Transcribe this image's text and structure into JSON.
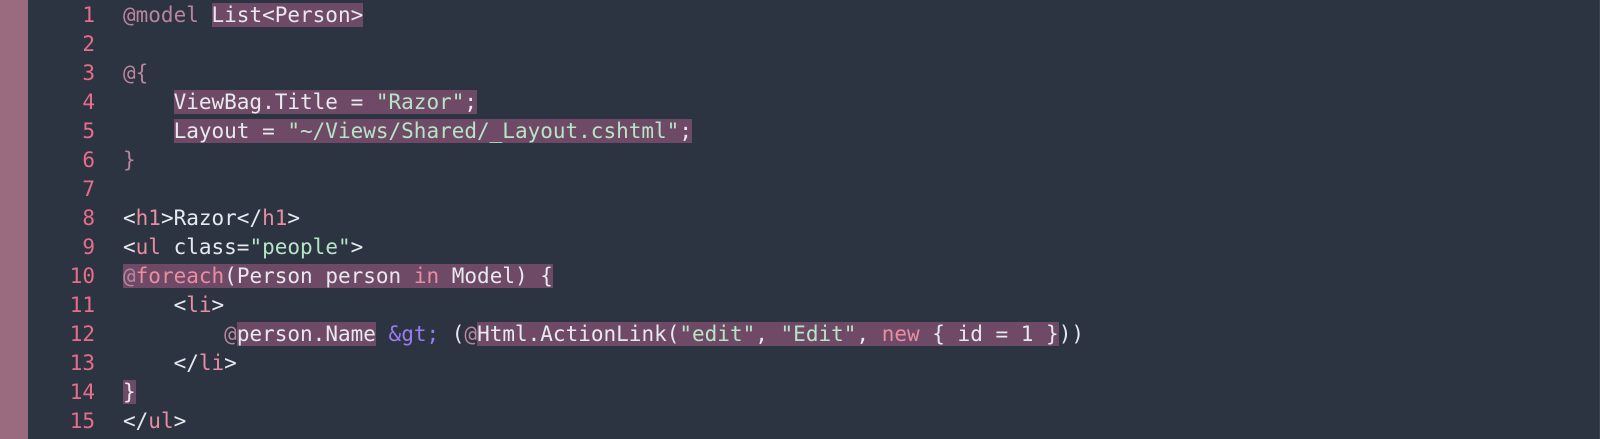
{
  "editor": {
    "language": "Razor (cshtml)",
    "colors": {
      "background": "#2c3441",
      "gutter_bar": "#9a6a7e",
      "line_number": "#e86d8a",
      "highlight": "#6f4a66"
    },
    "lines": [
      {
        "number": "1",
        "segments": [
          {
            "text": "@model ",
            "cls": "at"
          },
          {
            "text": "List<Person>",
            "cls": "pun hl"
          }
        ]
      },
      {
        "number": "2",
        "segments": []
      },
      {
        "number": "3",
        "segments": [
          {
            "text": "@{",
            "cls": "at"
          }
        ]
      },
      {
        "number": "4",
        "segments": [
          {
            "text": "    ",
            "cls": ""
          },
          {
            "text": "ViewBag.Title = ",
            "cls": "pun hl"
          },
          {
            "text": "\"Razor\"",
            "cls": "str hl"
          },
          {
            "text": ";",
            "cls": "pun hl"
          }
        ]
      },
      {
        "number": "5",
        "segments": [
          {
            "text": "    ",
            "cls": ""
          },
          {
            "text": "Layout = ",
            "cls": "pun hl"
          },
          {
            "text": "\"~/Views/Shared/_Layout.cshtml\"",
            "cls": "str hl"
          },
          {
            "text": ";",
            "cls": "pun hl"
          }
        ]
      },
      {
        "number": "6",
        "segments": [
          {
            "text": "}",
            "cls": "at"
          }
        ]
      },
      {
        "number": "7",
        "segments": []
      },
      {
        "number": "8",
        "segments": [
          {
            "text": "<",
            "cls": "pun"
          },
          {
            "text": "h1",
            "cls": "tag"
          },
          {
            "text": ">Razor</",
            "cls": "pun"
          },
          {
            "text": "h1",
            "cls": "tag"
          },
          {
            "text": ">",
            "cls": "pun"
          }
        ]
      },
      {
        "number": "9",
        "segments": [
          {
            "text": "<",
            "cls": "pun"
          },
          {
            "text": "ul",
            "cls": "tag"
          },
          {
            "text": " class=",
            "cls": "pun"
          },
          {
            "text": "\"people\"",
            "cls": "str"
          },
          {
            "text": ">",
            "cls": "pun"
          }
        ]
      },
      {
        "number": "10",
        "segments": [
          {
            "text": "@",
            "cls": "at hl"
          },
          {
            "text": "foreach",
            "cls": "kw hl"
          },
          {
            "text": "(Person person ",
            "cls": "pun hl"
          },
          {
            "text": "in",
            "cls": "kw hl"
          },
          {
            "text": " Model) {",
            "cls": "pun hl"
          }
        ]
      },
      {
        "number": "11",
        "segments": [
          {
            "text": "    <",
            "cls": "pun"
          },
          {
            "text": "li",
            "cls": "tag"
          },
          {
            "text": ">",
            "cls": "pun"
          }
        ]
      },
      {
        "number": "12",
        "segments": [
          {
            "text": "        ",
            "cls": ""
          },
          {
            "text": "@",
            "cls": "at"
          },
          {
            "text": "person.Name",
            "cls": "pun hl"
          },
          {
            "text": " ",
            "cls": ""
          },
          {
            "text": "&gt;",
            "cls": "ent"
          },
          {
            "text": " (",
            "cls": "pun"
          },
          {
            "text": "@",
            "cls": "at"
          },
          {
            "text": "Html.ActionLink(",
            "cls": "pun hl"
          },
          {
            "text": "\"edit\"",
            "cls": "str hl"
          },
          {
            "text": ", ",
            "cls": "pun hl"
          },
          {
            "text": "\"Edit\"",
            "cls": "str hl"
          },
          {
            "text": ", ",
            "cls": "pun hl"
          },
          {
            "text": "new",
            "cls": "kw hl"
          },
          {
            "text": " { id = 1 }",
            "cls": "pun hl"
          },
          {
            "text": "))",
            "cls": "pun"
          }
        ]
      },
      {
        "number": "13",
        "segments": [
          {
            "text": "    </",
            "cls": "pun"
          },
          {
            "text": "li",
            "cls": "tag"
          },
          {
            "text": ">",
            "cls": "pun"
          }
        ]
      },
      {
        "number": "14",
        "segments": [
          {
            "text": "}",
            "cls": "pun hl"
          }
        ]
      },
      {
        "number": "15",
        "segments": [
          {
            "text": "</",
            "cls": "pun"
          },
          {
            "text": "ul",
            "cls": "tag"
          },
          {
            "text": ">",
            "cls": "pun"
          }
        ]
      }
    ]
  }
}
